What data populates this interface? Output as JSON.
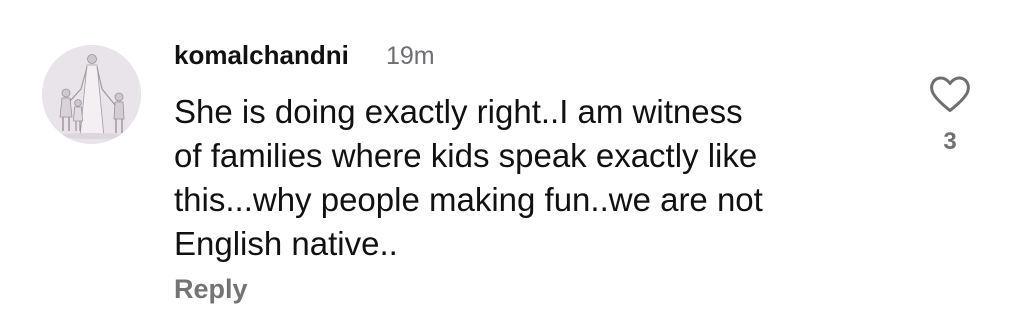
{
  "comment": {
    "avatar_icon": "avatar-family-illustration",
    "username": "komalchandni",
    "timestamp": "19m",
    "text_lines": [
      "She is doing exactly right..I am witness",
      "of families where kids speak exactly like",
      "this...why people making fun..we are not",
      "English native.."
    ],
    "reply_label": "Reply",
    "like_icon": "heart-icon",
    "like_count": "3"
  },
  "colors": {
    "text": "#111111",
    "muted": "#747474",
    "timestamp": "#6e6e73",
    "avatar_bg": "#e9e4ea"
  }
}
